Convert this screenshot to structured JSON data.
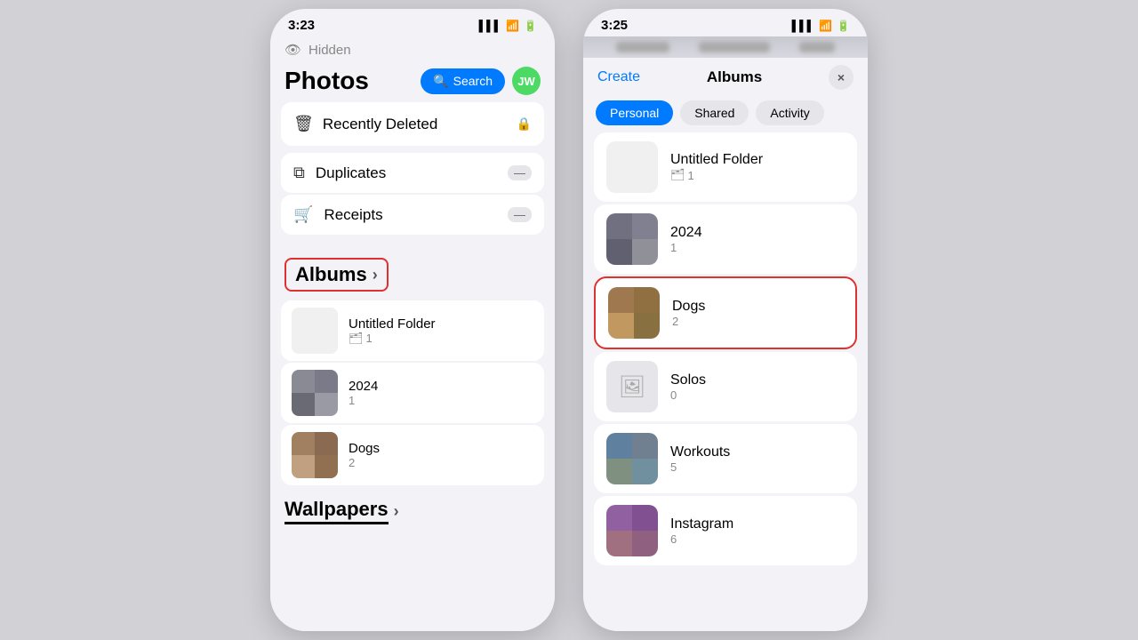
{
  "phone1": {
    "status_time": "3:23",
    "status_signal": "▌▌▌",
    "status_wifi": "WiFi",
    "status_battery": "55",
    "hidden_label": "Hidden",
    "title": "Photos",
    "search_label": "Search",
    "avatar_label": "JW",
    "menu": [
      {
        "icon": "🗑",
        "label": "Recently Deleted",
        "extra": "🔒"
      },
      {
        "icon": "⧉",
        "label": "Duplicates",
        "badge": "—"
      },
      {
        "icon": "🛒",
        "label": "Receipts",
        "badge": "—"
      }
    ],
    "albums_section_label": "Albums",
    "albums_chevron": "›",
    "albums": [
      {
        "name": "Untitled Folder",
        "count": "1",
        "type": "folder"
      },
      {
        "name": "2024",
        "count": "1",
        "type": "mosaic"
      },
      {
        "name": "Dogs",
        "count": "2",
        "type": "dogs"
      }
    ],
    "wallpapers_label": "Wallpapers",
    "wallpapers_chevron": "›"
  },
  "phone2": {
    "status_time": "3:25",
    "create_label": "Create",
    "modal_title": "Albums",
    "close_label": "×",
    "tabs": [
      {
        "label": "Personal",
        "active": true
      },
      {
        "label": "Shared",
        "active": false
      },
      {
        "label": "Activity",
        "active": false
      }
    ],
    "albums": [
      {
        "name": "Untitled Folder",
        "count": "1",
        "icon": "🗂",
        "type": "folder",
        "highlighted": false
      },
      {
        "name": "2024",
        "count": "1",
        "type": "mosaic-2024",
        "highlighted": false
      },
      {
        "name": "Dogs",
        "count": "2",
        "type": "mosaic-dogs",
        "highlighted": true
      },
      {
        "name": "Solos",
        "count": "0",
        "type": "solos",
        "highlighted": false
      },
      {
        "name": "Workouts",
        "count": "5",
        "type": "mosaic-workouts",
        "highlighted": false
      },
      {
        "name": "Instagram",
        "count": "6",
        "type": "mosaic-instagram",
        "highlighted": false
      }
    ]
  }
}
